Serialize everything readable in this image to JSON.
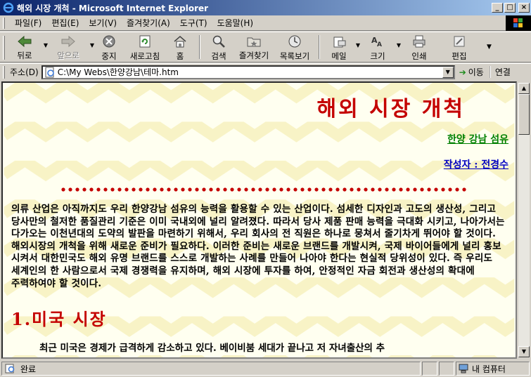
{
  "window": {
    "title": "해외 시장 개척 - Microsoft Internet Explorer"
  },
  "menu": [
    "파일(F)",
    "편집(E)",
    "보기(V)",
    "즐겨찾기(A)",
    "도구(T)",
    "도움말(H)"
  ],
  "toolbar": {
    "back": "뒤로",
    "forward": "앞으로",
    "stop": "중지",
    "refresh": "새로고침",
    "home": "홈",
    "search": "검색",
    "favorites": "즐겨찾기",
    "history": "목록보기",
    "mail": "메일",
    "size": "크기",
    "print": "인쇄",
    "edit": "편집"
  },
  "address": {
    "label": "주소(D)",
    "value": "C:\\My Webs\\한양강남\\테마.htm",
    "go": "이동",
    "links": "연결"
  },
  "page": {
    "title": "해외 시장 개척",
    "company": "한양 강남 섬유",
    "author": "작성자 : 전경수",
    "body": "의류 산업은 아직까지도 우리 한양강남 섬유의 능력을 활용할 수 있는 산업이다. 섬세한 디자인과 고도의 생산성, 그리고 당사만의 철저한 품질관리 기준은 이미 국내외에 널리 알려졌다. 따라서 당사 제품 판매 능력을 극대화 시키고, 나아가서는 다가오는 이천년대의 도약의 발판을 마련하기 위해서, 우리 회사의 전 직원은 하나로 뭉쳐서 줄기차게 뛰어야 할 것이다.해외시장의 개척을 위해 새로운 준비가 필요하다. 이러한 준비는 새로운 브랜드를 개발시켜, 국제 바이어들에게 널리 홍보 시켜서 대한민국도 해외 유명 브랜드를 스스로 개발하는 사례를 만들어 나아야 한다는 현실적 당위성이 있다. 즉 우리도 세계인의 한 사람으로서 국제 경쟁력을 유지하며, 해외 시장에 투자를 하여, 안정적인 자금 회전과 생산성의 확대에 주력하여야 할 것이다.",
    "section1": "1.미국 시장",
    "section1_text": "최근 미국은 경제가 급격하게 감소하고 있다. 베이비붐 세대가 끝나고 저 자녀출산의 추"
  },
  "status": {
    "text": "완료",
    "zone": "내 컴퓨터"
  },
  "colors": {
    "titlebar_start": "#0a246a",
    "heading_red": "#c40000",
    "company_green": "#008000",
    "author_blue": "#0000c0"
  }
}
